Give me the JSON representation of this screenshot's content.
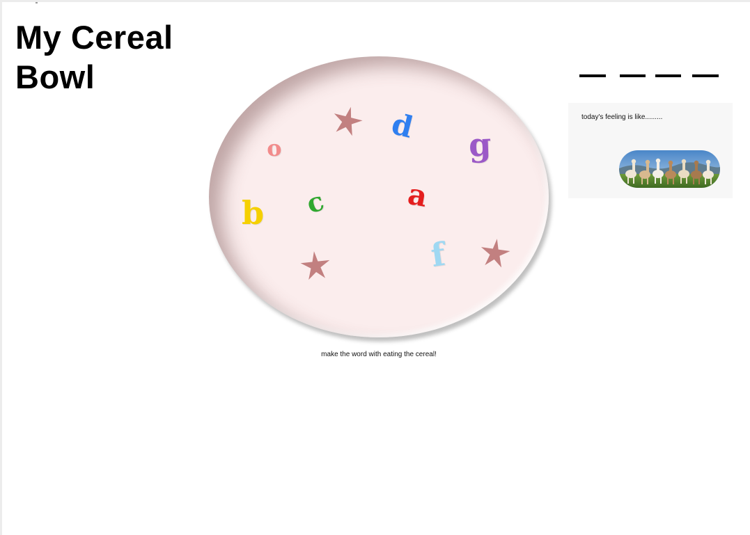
{
  "page": {
    "title": "My Cereal Bowl",
    "caption": "make the word with eating the cereal!"
  },
  "cereal": [
    {
      "name": "cereal-letter-o",
      "char": "o",
      "color": "#f28b8b"
    },
    {
      "name": "cereal-letter-d",
      "char": "d",
      "color": "#2f7ff0"
    },
    {
      "name": "cereal-letter-g",
      "char": "g",
      "color": "#9b59c7"
    },
    {
      "name": "cereal-letter-b",
      "char": "b",
      "color": "#f5d000"
    },
    {
      "name": "cereal-letter-c",
      "char": "c",
      "color": "#2fa82f"
    },
    {
      "name": "cereal-letter-a",
      "char": "a",
      "color": "#e41e1e"
    },
    {
      "name": "cereal-letter-f",
      "char": "f",
      "color": "#9fd8f2"
    }
  ],
  "stars": {
    "color": "#c28080",
    "count": 3
  },
  "word_blanks": 4,
  "feeling": {
    "label": "today's feeling is like.........",
    "image_icon": "alpaca-herd-photo"
  }
}
